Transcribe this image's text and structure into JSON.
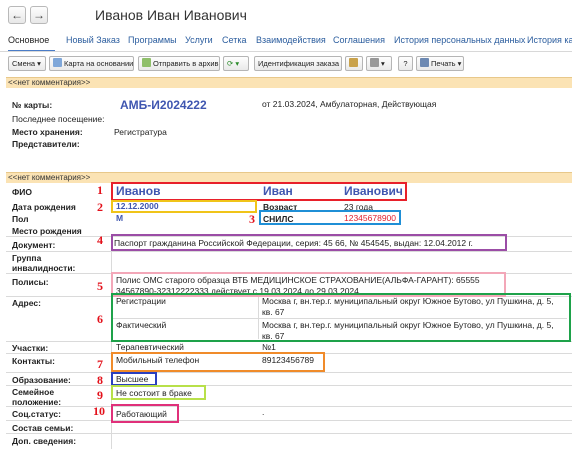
{
  "window": {
    "title": "Иванов Иван Иванович",
    "back_glyph": "←",
    "forward_glyph": "→"
  },
  "tabs": [
    {
      "label": "Основное",
      "active": true
    },
    {
      "label": "Новый Заказ"
    },
    {
      "label": "Программы"
    },
    {
      "label": "Услуги"
    },
    {
      "label": "Сетка"
    },
    {
      "label": "Взаимодействия"
    },
    {
      "label": "Соглашения"
    },
    {
      "label": "История персональных данных"
    },
    {
      "label": "История кар"
    }
  ],
  "toolbar": {
    "change": "Смена",
    "card_based": "Карта на основании",
    "send_archive": "Отправить в архив",
    "refresh_glyph": "⟳",
    "order_id": "Идентификация заказа",
    "help": "?",
    "print": "Печать"
  },
  "card": {
    "no_comment": "<<нет комментария>>",
    "card_no_label": "№ карты:",
    "card_no": "АМБ-И2024222",
    "card_info": "от 21.03.2024, Амбулаторная, Действующая",
    "last_visit_label": "Последнее посещение:",
    "storage_label": "Место хранения:",
    "storage": "Регистратура",
    "reps_label": "Представители:"
  },
  "patient": {
    "no_comment": "<<нет комментария>>",
    "fio_label": "ФИО",
    "last_name": "Иванов",
    "first_name": "Иван",
    "middle_name": "Иванович",
    "dob_label": "Дата рождения",
    "dob": "12.12.2000",
    "age_label": "Возраст",
    "age": "23 года",
    "sex_label": "Пол",
    "sex": "М",
    "snils_label": "СНИЛС",
    "snils": "12345678900",
    "birthplace_label": "Место рождения",
    "document_label": "Документ:",
    "document": "Паспорт гражданина Российской Федерации, серия: 45 66, № 454545, выдан: 12.04.2012 г.",
    "disability_label1": "Группа",
    "disability_label2": "инвалидности:",
    "policy_label": "Полисы:",
    "policy_line1": "Полис ОМС старого образца ВТБ МЕДИЦИНСКОЕ СТРАХОВАНИЕ(АЛЬФА-ГАРАНТ): 65555",
    "policy_line2": "34567890-32312222333 действует с 19.03.2024 до 29.03.2024",
    "address_label": "Адрес:",
    "addr_reg_label": "Регистрации",
    "addr_reg": "Москва г, вн.тер.г. муниципальный округ Южное Бутово, ул Пушкина, д. 5, кв. 67",
    "addr_fact_label": "Фактический",
    "addr_fact": "Москва г, вн.тер.г. муниципальный округ Южное Бутово, ул Пушкина, д. 5, кв. 67",
    "area_label": "Участки:",
    "area_type": "Терапевтический",
    "area_no": "№1",
    "contacts_label": "Контакты:",
    "phone_label": "Мобильный телефон",
    "phone": "89123456789",
    "education_label": "Образование:",
    "education": "Высшее",
    "marital_label1": "Семейное",
    "marital_label2": "положение:",
    "marital": "Не состоит в браке",
    "social_label": "Соц.статус:",
    "social": "Работающий",
    "social_extra": ".",
    "family_label": "Состав семьи:",
    "extra_label": "Доп. сведения:"
  },
  "annotations": [
    "1",
    "2",
    "3",
    "4",
    "5",
    "6",
    "7",
    "8",
    "9",
    "10"
  ],
  "colors": {
    "band": "#fbe3b4",
    "link": "#2b5d9e",
    "name_blue": "#3f56b0",
    "red": "#e3101a",
    "ann_red": "#e8202a",
    "ann_yellow": "#f0c419",
    "ann_blue": "#1f8fd6",
    "ann_purple": "#9b4da6",
    "ann_pink": "#f3a7b8",
    "ann_green": "#1ea24a",
    "ann_orange": "#f08b2a",
    "ann_navy": "#2a3fbf",
    "ann_lime": "#b8e04a",
    "ann_magenta": "#e0307a"
  }
}
